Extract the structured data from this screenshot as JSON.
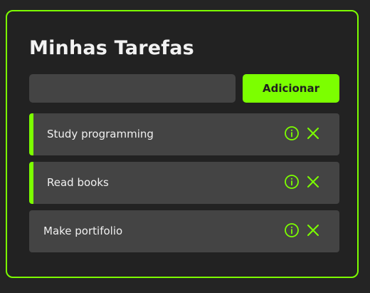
{
  "app": {
    "title": "Minhas Tarefas"
  },
  "form": {
    "input_value": "",
    "input_placeholder": "",
    "add_label": "Adicionar"
  },
  "tasks": [
    {
      "text": "Study programming",
      "completed": true
    },
    {
      "text": "Read books",
      "completed": true
    },
    {
      "text": "Make portifolio",
      "completed": false
    }
  ],
  "icons": {
    "info": "info-circle-icon",
    "remove": "close-icon"
  },
  "colors": {
    "accent": "#7cff00",
    "background": "#242424",
    "card": "#222222",
    "item": "#444444",
    "text": "#f0f0f0"
  }
}
